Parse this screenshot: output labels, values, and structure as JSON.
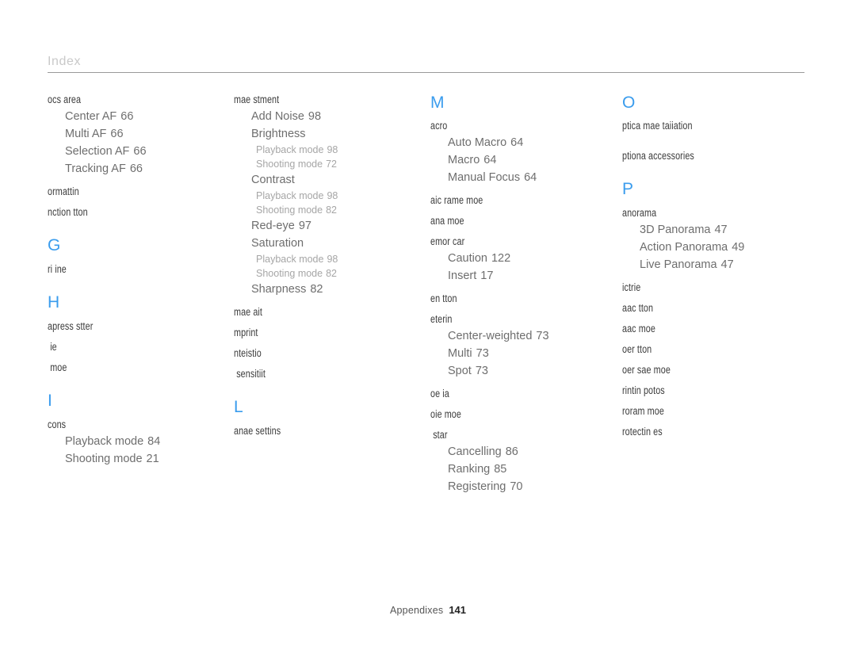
{
  "header": {
    "title": "Index"
  },
  "footer": {
    "label": "Appendixes",
    "page": "141"
  },
  "colors": {
    "letter_heading": "#3a9ced",
    "entry_level1": "#3c3c3c",
    "entry_level2": "#6e6e6e",
    "entry_level3": "#a6a6a6",
    "rule": "#9a9a9a",
    "title": "#c9c9c9"
  },
  "columns": [
    {
      "id": "column-1",
      "blocks": [
        {
          "type": "entry1",
          "text": "ocs area"
        },
        {
          "type": "entry2",
          "text": "Center AF",
          "num": "66"
        },
        {
          "type": "entry2",
          "text": "Multi AF",
          "num": "66"
        },
        {
          "type": "entry2",
          "text": "Selection AF",
          "num": "66"
        },
        {
          "type": "entry2",
          "text": "Tracking AF",
          "num": "66"
        },
        {
          "type": "entry1",
          "text": "ormattin"
        },
        {
          "type": "entry1",
          "text": "nction tton"
        },
        {
          "type": "letter",
          "text": "G"
        },
        {
          "type": "entry1",
          "text": "ri ine"
        },
        {
          "type": "letter",
          "text": "H"
        },
        {
          "type": "entry1",
          "text": "apress stter"
        },
        {
          "type": "entry1",
          "text": "ie",
          "indent": true
        },
        {
          "type": "entry1",
          "text": "moe",
          "indent": true
        },
        {
          "type": "letter",
          "text": "I"
        },
        {
          "type": "entry1",
          "text": "cons"
        },
        {
          "type": "entry2",
          "text": "Playback mode",
          "num": "84"
        },
        {
          "type": "entry2",
          "text": "Shooting mode",
          "num": "21"
        }
      ]
    },
    {
      "id": "column-2",
      "blocks": [
        {
          "type": "entry1",
          "text": "mae stment"
        },
        {
          "type": "entry2",
          "text": "Add Noise",
          "num": "98"
        },
        {
          "type": "entry2",
          "text": "Brightness",
          "num": ""
        },
        {
          "type": "entry3",
          "text": "Playback mode",
          "num": "98"
        },
        {
          "type": "entry3",
          "text": "Shooting mode",
          "num": "72"
        },
        {
          "type": "entry2",
          "text": "Contrast",
          "num": ""
        },
        {
          "type": "entry3",
          "text": "Playback mode",
          "num": "98"
        },
        {
          "type": "entry3",
          "text": "Shooting mode",
          "num": "82"
        },
        {
          "type": "entry2",
          "text": "Red-eye",
          "num": "97"
        },
        {
          "type": "entry2",
          "text": "Saturation",
          "num": ""
        },
        {
          "type": "entry3",
          "text": "Playback mode",
          "num": "98"
        },
        {
          "type": "entry3",
          "text": "Shooting mode",
          "num": "82"
        },
        {
          "type": "entry2",
          "text": "Sharpness",
          "num": "82"
        },
        {
          "type": "entry1",
          "text": "mae ait"
        },
        {
          "type": "entry1",
          "text": "mprint"
        },
        {
          "type": "entry1",
          "text": "nteistio"
        },
        {
          "type": "entry1",
          "text": "sensitiit",
          "indent": true
        },
        {
          "type": "letter",
          "text": "L"
        },
        {
          "type": "entry1",
          "text": "anae settins"
        }
      ]
    },
    {
      "id": "column-3",
      "blocks": [
        {
          "type": "letter",
          "text": "M",
          "first": true
        },
        {
          "type": "entry1",
          "text": "acro"
        },
        {
          "type": "entry2",
          "text": "Auto Macro",
          "num": "64"
        },
        {
          "type": "entry2",
          "text": "Macro",
          "num": "64"
        },
        {
          "type": "entry2",
          "text": "Manual Focus",
          "num": "64"
        },
        {
          "type": "entry1",
          "text": "aic rame moe"
        },
        {
          "type": "entry1",
          "text": "ana moe"
        },
        {
          "type": "entry1",
          "text": "emor car"
        },
        {
          "type": "entry2",
          "text": "Caution",
          "num": "122"
        },
        {
          "type": "entry2",
          "text": "Insert",
          "num": "17"
        },
        {
          "type": "entry1",
          "text": "en tton"
        },
        {
          "type": "entry1",
          "text": "eterin"
        },
        {
          "type": "entry2",
          "text": "Center-weighted",
          "num": "73"
        },
        {
          "type": "entry2",
          "text": "Multi",
          "num": "73"
        },
        {
          "type": "entry2",
          "text": "Spot",
          "num": "73"
        },
        {
          "type": "entry1",
          "text": "oe ia"
        },
        {
          "type": "entry1",
          "text": "oie moe"
        },
        {
          "type": "entry1",
          "text": "star",
          "indent": true
        },
        {
          "type": "entry2",
          "text": "Cancelling",
          "num": "86"
        },
        {
          "type": "entry2",
          "text": "Ranking",
          "num": "85"
        },
        {
          "type": "entry2",
          "text": "Registering",
          "num": "70"
        }
      ]
    },
    {
      "id": "column-4",
      "blocks": [
        {
          "type": "letter",
          "text": "O",
          "first": true
        },
        {
          "type": "entry1",
          "text": "ptica mae taiiation"
        },
        {
          "type": "gap",
          "size": "sm"
        },
        {
          "type": "entry1",
          "text": "ptiona accessories"
        },
        {
          "type": "letter",
          "text": "P"
        },
        {
          "type": "entry1",
          "text": "anorama"
        },
        {
          "type": "entry2",
          "text": "3D Panorama",
          "num": "47"
        },
        {
          "type": "entry2",
          "text": "Action Panorama",
          "num": "49"
        },
        {
          "type": "entry2",
          "text": "Live Panorama",
          "num": "47"
        },
        {
          "type": "entry1",
          "text": "ictrie"
        },
        {
          "type": "entry1",
          "text": "aac tton"
        },
        {
          "type": "entry1",
          "text": "aac moe"
        },
        {
          "type": "entry1",
          "text": "oer tton"
        },
        {
          "type": "entry1",
          "text": "oer sae moe"
        },
        {
          "type": "entry1",
          "text": "rintin potos"
        },
        {
          "type": "entry1",
          "text": "roram moe"
        },
        {
          "type": "entry1",
          "text": "rotectin es"
        }
      ]
    }
  ]
}
